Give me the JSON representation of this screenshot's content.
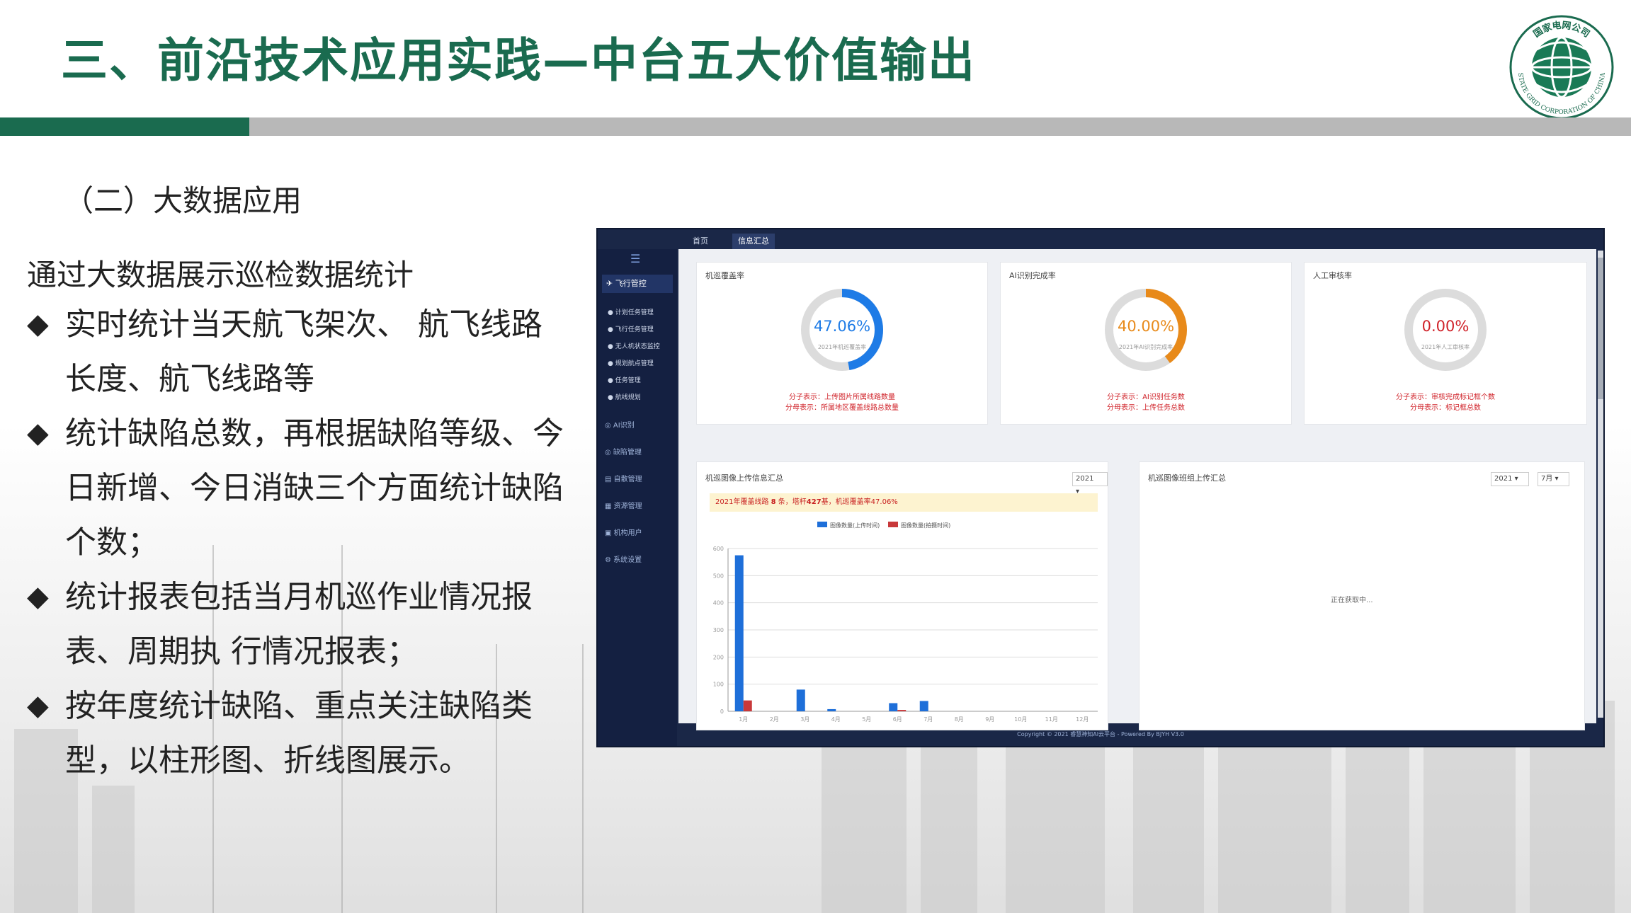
{
  "slide": {
    "title": "三、前沿技术应用实践—中台五大价值输出",
    "subtitle": "（二）大数据应用",
    "intro": "通过大数据展示巡检数据统计",
    "bullets": [
      "实时统计当天航飞架次、 航飞线路长度、航飞线路等",
      "统计缺陷总数，再根据缺陷等级、今日新增、今日消缺三个方面统计缺陷个数；",
      "统计报表包括当月机巡作业情况报表、周期执 行情况报表；",
      "按年度统计缺陷、重点关注缺陷类型，以柱形图、折线图展示。"
    ],
    "bullet_symbol": "◆",
    "logo": {
      "top_text": "国家电网公司",
      "ring_text": "STATE GRID CORPORATION OF CHINA",
      "icon": "state-grid-globe-logo"
    },
    "colors": {
      "brand_green": "#1a6b4f",
      "gray_bar": "#b8b8b8"
    }
  },
  "app": {
    "tabs": [
      "首页",
      "信息汇总"
    ],
    "sidebar": {
      "menu_icon": "☰",
      "header": "飞行管控",
      "sub_items": [
        "计划任务管理",
        "飞行任务管理",
        "无人机状态监控",
        "规划航点管理",
        "任务管理",
        "航线规划"
      ],
      "main_items": [
        "AI识别",
        "缺陷管理",
        "自散管理",
        "资源管理",
        "机构用户",
        "系统设置"
      ]
    },
    "cards": [
      {
        "title": "机巡覆盖率",
        "pct": "47.06%",
        "value": 0.4706,
        "caption": "2021年机巡覆盖率",
        "color": "#1e7be6",
        "legend": [
          "分子表示：上传图片所属线路数量",
          "分母表示：所属地区覆盖线路总数量"
        ]
      },
      {
        "title": "AI识别完成率",
        "pct": "40.00%",
        "value": 0.4,
        "caption": "2021年AI识别完成率",
        "color": "#e88a1a",
        "legend": [
          "分子表示：AI识别任务数",
          "分母表示：上传任务总数"
        ]
      },
      {
        "title": "人工审核率",
        "pct": "0.00%",
        "value": 0,
        "caption": "2021年人工审核率",
        "color": "#d0232a",
        "legend": [
          "分子表示：审核完成标记框个数",
          "分母表示：标记框总数"
        ]
      }
    ],
    "chart_panel": {
      "title": "机巡图像上传信息汇总",
      "year": "2021",
      "banner_prefix": "2021年覆盖线路",
      "banner_lines": "8",
      "banner_mid": "条，塔杆",
      "banner_towers": "427",
      "banner_mid2": "基，机巡覆盖率",
      "banner_pct": "47.06%"
    },
    "group_panel": {
      "title": "机巡图像班组上传汇总",
      "year": "2021",
      "month": "7月",
      "loading": "正在获取中..."
    },
    "footer": "Copyright © 2021 睿慧神知AI云平台 - Powered By BJYH V3.0"
  },
  "chart_data": {
    "type": "bar",
    "categories": [
      "1月",
      "2月",
      "3月",
      "4月",
      "5月",
      "6月",
      "7月",
      "8月",
      "9月",
      "10月",
      "11月",
      "12月"
    ],
    "series": [
      {
        "name": "图像数量(上传时间)",
        "color": "#1e6fd9",
        "values": [
          575,
          0,
          80,
          8,
          0,
          30,
          38,
          0,
          0,
          0,
          0,
          0
        ]
      },
      {
        "name": "图像数量(拍摄时间)",
        "color": "#c8383a",
        "values": [
          40,
          0,
          0,
          0,
          0,
          5,
          0,
          0,
          0,
          0,
          0,
          0
        ]
      }
    ],
    "yticks": [
      0,
      100,
      200,
      300,
      400,
      500,
      600
    ],
    "ylim": [
      0,
      600
    ],
    "grid": true,
    "legend": "top"
  }
}
